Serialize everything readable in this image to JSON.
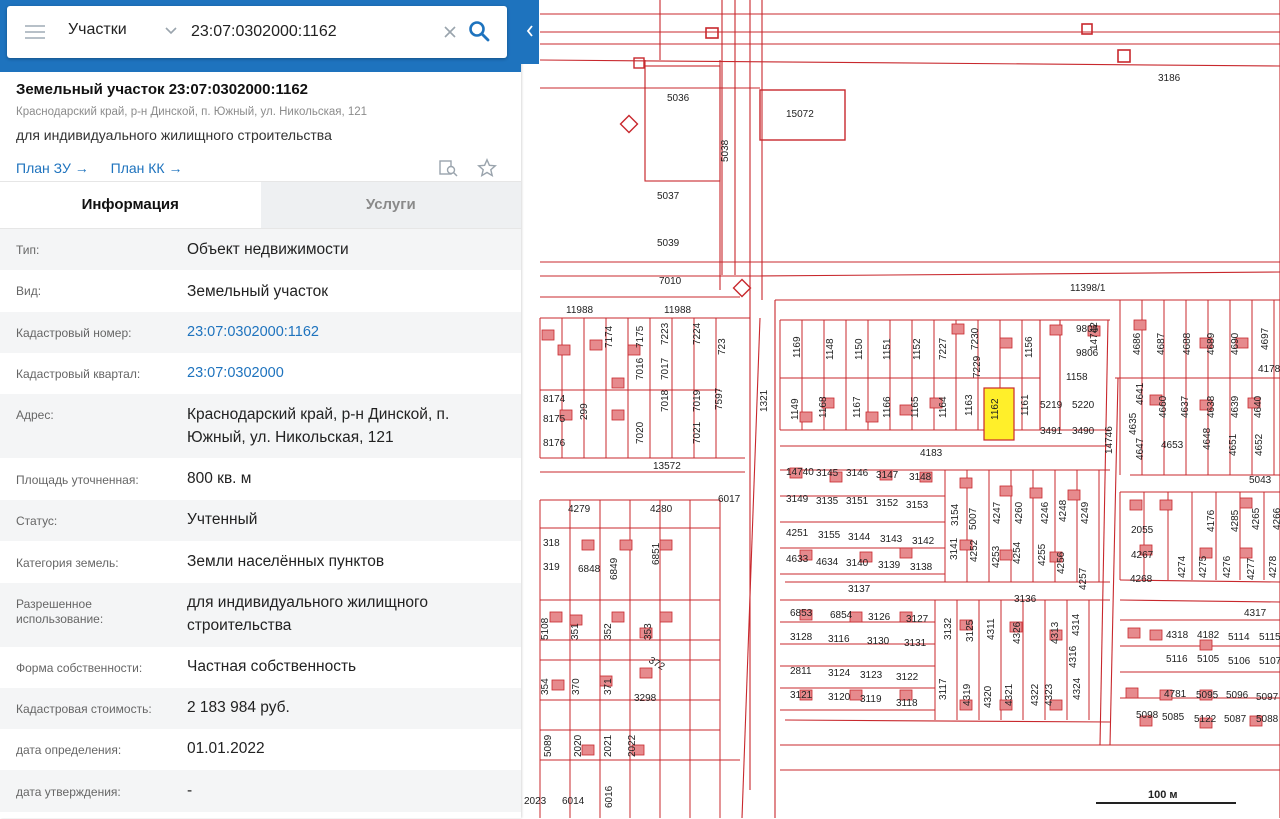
{
  "search": {
    "type_label": "Участки",
    "query": "23:07:0302000:1162"
  },
  "parcel": {
    "title": "Земельный участок 23:07:0302000:1162",
    "address_small": "Краснодарский край, р-н Динской, п. Южный, ул. Никольская, 121",
    "purpose": "для индивидуального жилищного строительства",
    "link_plan_zu": "План ЗУ",
    "link_plan_kk": "План КК"
  },
  "tabs": [
    {
      "label": "Информация",
      "active": true
    },
    {
      "label": "Услуги",
      "active": false
    }
  ],
  "info_rows": [
    {
      "label": "Тип:",
      "value": "Объект недвижимости",
      "link": false
    },
    {
      "label": "Вид:",
      "value": "Земельный участок",
      "link": false
    },
    {
      "label": "Кадастровый номер:",
      "value": "23:07:0302000:1162",
      "link": true
    },
    {
      "label": "Кадастровый квартал:",
      "value": "23:07:0302000",
      "link": true
    },
    {
      "label": "Адрес:",
      "value": "Краснодарский край, р-н Динской, п. Южный, ул. Никольская, 121",
      "link": false
    },
    {
      "label": "Площадь уточненная:",
      "value": "800 кв. м",
      "link": false
    },
    {
      "label": "Статус:",
      "value": "Учтенный",
      "link": false
    },
    {
      "label": "Категория земель:",
      "value": "Земли населённых пунктов",
      "link": false
    },
    {
      "label": "Разрешенное использование:",
      "value": "для индивидуального жилищного строительства",
      "link": false
    },
    {
      "label": "Форма собственности:",
      "value": "Частная собственность",
      "link": false
    },
    {
      "label": "Кадастровая стоимость:",
      "value": "2 183 984 руб.",
      "link": false
    },
    {
      "label": "дата определения:",
      "value": "01.01.2022",
      "link": false
    },
    {
      "label": "дата утверждения:",
      "value": "-",
      "link": false
    }
  ],
  "map": {
    "scale_label": "100 м",
    "line_color": "#c8282d",
    "highlight_color": "#ffef2a",
    "highlight_label": "1162",
    "labels": [
      "5036",
      "15072",
      "5038",
      "5037",
      "5039",
      "7010",
      "3186",
      "11398/1",
      "11988",
      "11988",
      "7174",
      "7175",
      "7223",
      "7224",
      "723",
      "7016",
      "7017",
      "7018",
      "7019",
      "7020",
      "7021",
      "7597",
      "8174",
      "8175",
      "8176",
      "299",
      "13572",
      "1321",
      "1169",
      "1148",
      "1150",
      "1151",
      "1152",
      "7227",
      "7230",
      "1156",
      "9805",
      "9806",
      "14742",
      "1158",
      "7229",
      "1149",
      "1168",
      "1167",
      "1166",
      "1165",
      "1164",
      "1163",
      "1161",
      "5219",
      "5220",
      "3491",
      "3490",
      "14746",
      "4686",
      "4687",
      "4688",
      "4689",
      "4690",
      "4697",
      "4178",
      "4660",
      "4637",
      "4638",
      "4639",
      "4640",
      "4641",
      "4635",
      "4647",
      "4648",
      "4651",
      "4652",
      "4653",
      "5043",
      "4183",
      "14740",
      "3145",
      "3146",
      "3147",
      "3148",
      "3149",
      "3135",
      "3151",
      "3152",
      "3153",
      "3154",
      "5007",
      "4247",
      "4260",
      "4246",
      "4248",
      "4249",
      "4251",
      "3155",
      "3144",
      "3143",
      "3142",
      "3141",
      "4252",
      "4253",
      "4254",
      "4255",
      "4256",
      "4257",
      "4633",
      "4634",
      "3140",
      "3139",
      "3138",
      "3137",
      "3136",
      "2055",
      "4176",
      "4285",
      "4265",
      "4266",
      "4267",
      "4268",
      "4274",
      "4275",
      "4276",
      "4277",
      "4278",
      "4279",
      "4280",
      "318",
      "319",
      "6848",
      "6849",
      "6851",
      "6853",
      "6854",
      "3126",
      "3127",
      "3128",
      "3116",
      "3130",
      "3131",
      "3132",
      "3125",
      "4311",
      "4326",
      "4313",
      "4314",
      "4316",
      "4317",
      "4318",
      "4182",
      "5114",
      "5115",
      "5116",
      "5105",
      "5106",
      "5107",
      "5108",
      "351",
      "352",
      "353",
      "354",
      "370",
      "371",
      "372",
      "3298",
      "2811",
      "3124",
      "3123",
      "3122",
      "3121",
      "3120",
      "3119",
      "3118",
      "3117",
      "4319",
      "4320",
      "4321",
      "4322",
      "4323",
      "4324",
      "4781",
      "5095",
      "5096",
      "5097",
      "5098",
      "5085",
      "5122",
      "5087",
      "5088",
      "5089",
      "2020",
      "2021",
      "2022",
      "2023",
      "6014",
      "6016",
      "6017"
    ]
  }
}
